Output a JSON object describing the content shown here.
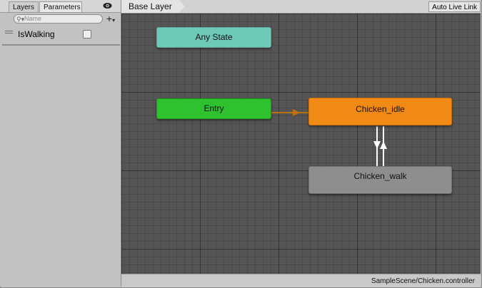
{
  "left_panel": {
    "tabs": [
      {
        "label": "Layers"
      },
      {
        "label": "Parameters"
      }
    ],
    "search": {
      "placeholder": "Name"
    },
    "parameters": [
      {
        "name": "IsWalking",
        "type": "bool",
        "value": false
      }
    ]
  },
  "graph": {
    "breadcrumb": "Base Layer",
    "auto_live_link_label": "Auto Live Link",
    "states": {
      "any_state": "Any State",
      "entry": "Entry",
      "idle": "Chicken_idle",
      "walk": "Chicken_walk"
    },
    "footer_path": "SampleScene/Chicken.controller"
  },
  "colors": {
    "any_state": "#6fc9b9",
    "entry": "#2ec22e",
    "default_state": "#f08a14",
    "state": "#8e8e8e",
    "entry_transition": "#b8730f",
    "transition": "#ffffff"
  }
}
